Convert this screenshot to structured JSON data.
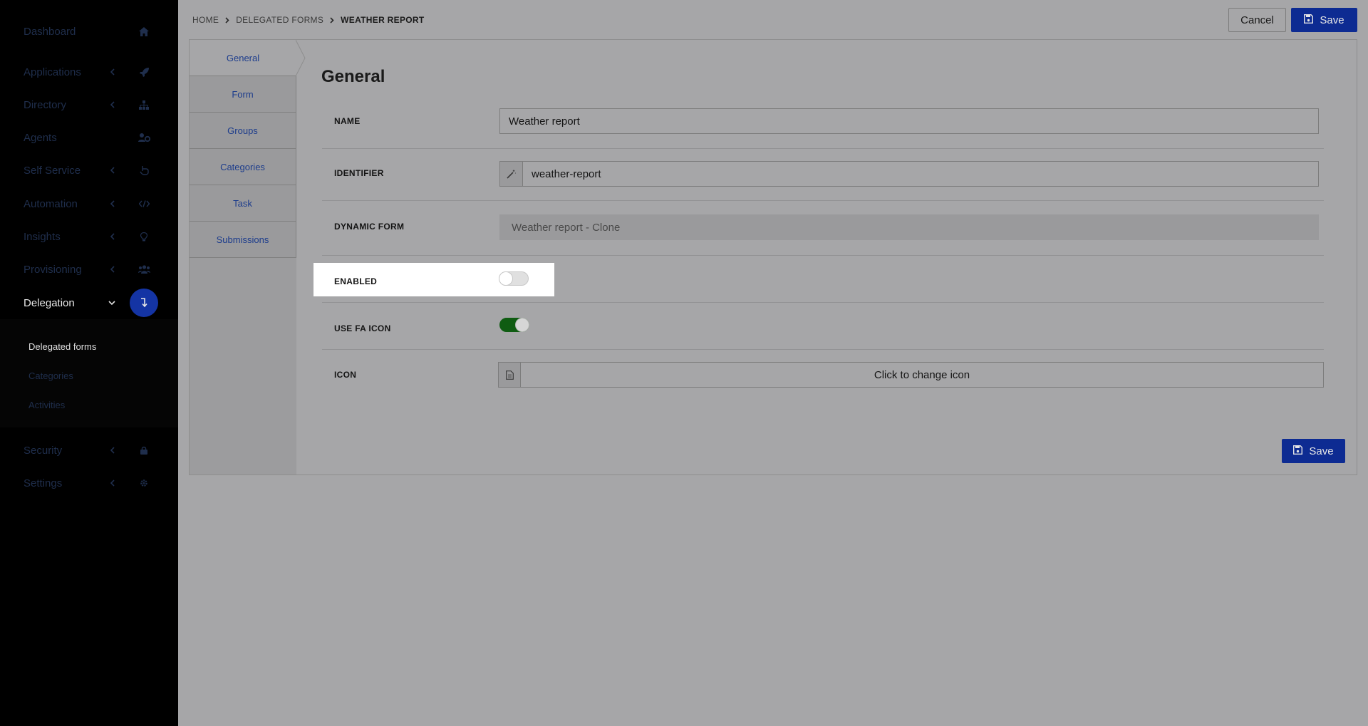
{
  "sidebar": {
    "items": [
      {
        "label": "Dashboard",
        "icon": "home-icon",
        "chevron": false
      },
      {
        "label": "Applications",
        "icon": "rocket-icon",
        "chevron": true
      },
      {
        "label": "Directory",
        "icon": "sitemap-icon",
        "chevron": true
      },
      {
        "label": "Agents",
        "icon": "users-cog-icon",
        "chevron": false
      },
      {
        "label": "Self Service",
        "icon": "hand-pointer-icon",
        "chevron": true
      },
      {
        "label": "Automation",
        "icon": "code-icon",
        "chevron": true
      },
      {
        "label": "Insights",
        "icon": "lightbulb-icon",
        "chevron": true
      },
      {
        "label": "Provisioning",
        "icon": "users-icon",
        "chevron": true
      },
      {
        "label": "Delegation",
        "icon": "level-down-icon",
        "chevron": true,
        "active": true
      },
      {
        "label": "Security",
        "icon": "lock-icon",
        "chevron": true
      },
      {
        "label": "Settings",
        "icon": "gear-icon",
        "chevron": true
      }
    ],
    "delegation_sub": [
      {
        "label": "Delegated forms",
        "active": true
      },
      {
        "label": "Categories"
      },
      {
        "label": "Activities"
      }
    ]
  },
  "breadcrumb": {
    "home": "HOME",
    "section": "DELEGATED FORMS",
    "current": "WEATHER REPORT"
  },
  "toolbar": {
    "cancel_label": "Cancel",
    "save_label": "Save"
  },
  "tabs": [
    "General",
    "Form",
    "Groups",
    "Categories",
    "Task",
    "Submissions"
  ],
  "form": {
    "title": "General",
    "name_label": "NAME",
    "name_value": "Weather report",
    "identifier_label": "IDENTIFIER",
    "identifier_value": "weather-report",
    "dynamic_form_label": "DYNAMIC FORM",
    "dynamic_form_value": "Weather report - Clone",
    "enabled_label": "ENABLED",
    "enabled": false,
    "use_fa_icon_label": "USE FA ICON",
    "use_fa_icon": true,
    "icon_label": "ICON",
    "icon_button_label": "Click to change icon",
    "save_label": "Save"
  },
  "colors": {
    "accent": "#0d2b92",
    "toggle_on": "#0f5c12",
    "sidebar_bg": "#000000"
  }
}
